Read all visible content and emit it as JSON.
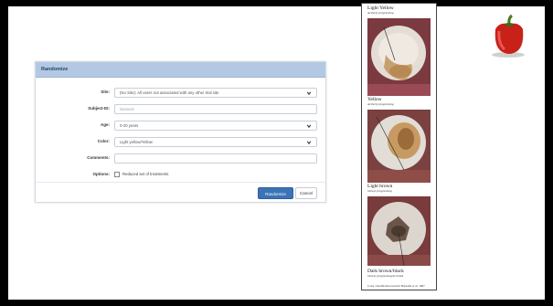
{
  "form": {
    "title": "Randomize",
    "site": {
      "label": "Site:",
      "value": "(No Site): All users not associated with any other trial site"
    },
    "subject_id": {
      "label": "Subject-ID:",
      "placeholder": "Numeric"
    },
    "age": {
      "label": "Age:",
      "value": "0-20 years"
    },
    "color": {
      "label": "Color:",
      "value": "Light yellow/Yellow"
    },
    "comments": {
      "label": "Comments:",
      "value": ""
    },
    "options": {
      "label": "Options:",
      "checkbox_label": "Reduced set of treatments",
      "checked": false
    },
    "randomize_label": "Randomize",
    "cancel_label": "Cancel"
  },
  "figure": {
    "panels": [
      {
        "title": "Light Yellow",
        "subtitle": "Actively progressing"
      },
      {
        "title": "Yellow",
        "subtitle": "Actively progressing"
      },
      {
        "title": "Light brown",
        "subtitle": "Slowly progressing"
      },
      {
        "title": "Dark brown/black",
        "subtitle": "Slowly progressing/arrested"
      }
    ],
    "note": "Color classification used in Barnafel et al. 1997"
  },
  "colors": {
    "header_bg": "#b3c9e3",
    "primary": "#3b73b6",
    "backdrop": "#000000"
  },
  "icons": {
    "dropdown": "chevron-down-icon",
    "decoration": "bell-pepper-icon"
  }
}
